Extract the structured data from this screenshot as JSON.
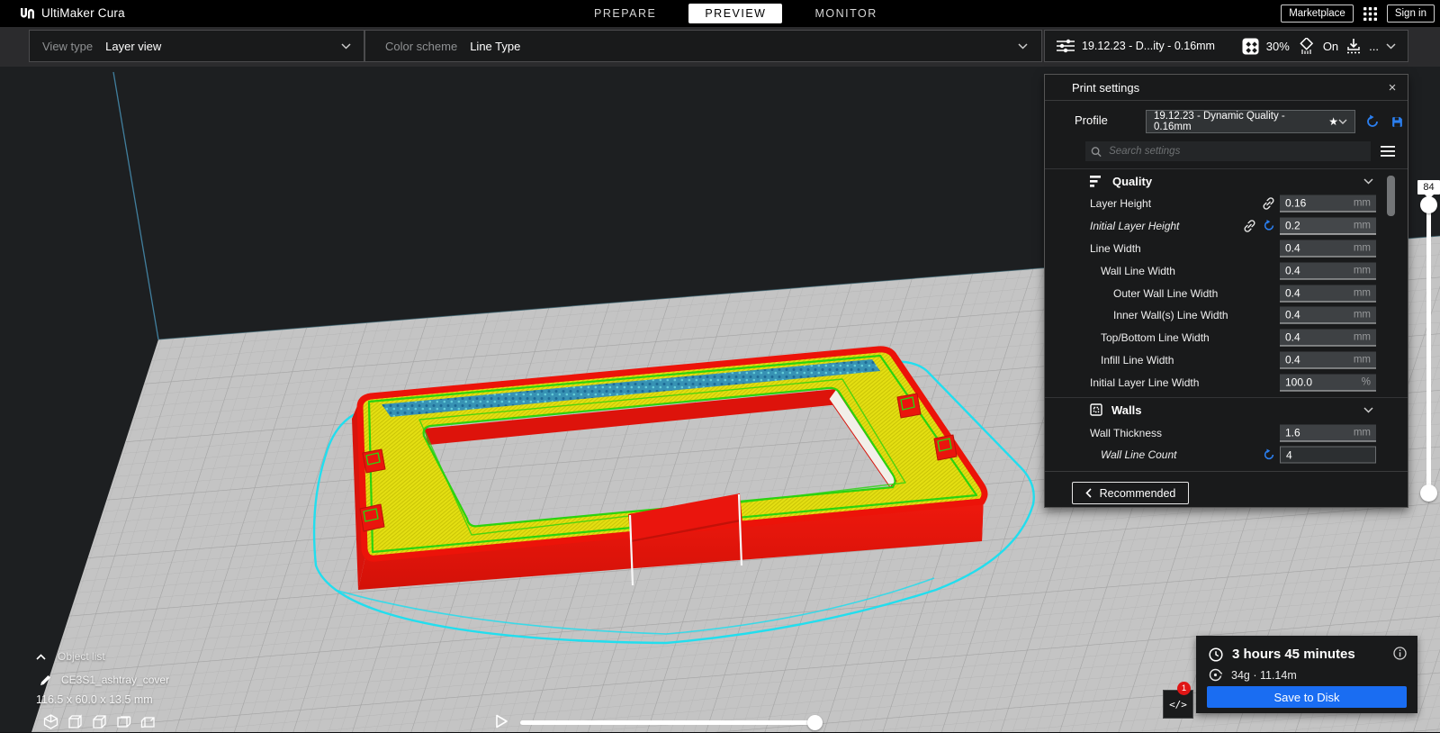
{
  "app": {
    "name": "UltiMaker Cura"
  },
  "top_bar": {
    "tabs": [
      {
        "label": "PREPARE"
      },
      {
        "label": "PREVIEW"
      },
      {
        "label": "MONITOR"
      }
    ],
    "active_tab": "PREVIEW",
    "marketplace_label": "Marketplace",
    "sign_in_label": "Sign in"
  },
  "view_bar": {
    "view_type_label": "View type",
    "view_type_value": "Layer view",
    "color_scheme_label": "Color scheme",
    "color_scheme_value": "Line Type",
    "summary": {
      "profile_short": "19.12.23 - D...ity - 0.16mm",
      "infill_percent": "30%",
      "support": "On",
      "more": "..."
    }
  },
  "print_settings": {
    "title": "Print settings",
    "profile_label": "Profile",
    "profile_value": "19.12.23 - Dynamic Quality - 0.16mm",
    "search_placeholder": "Search settings",
    "sections": [
      {
        "title": "Quality"
      },
      {
        "title": "Walls"
      }
    ],
    "rows": [
      {
        "label": "Layer Height",
        "value": "0.16",
        "unit": "mm"
      },
      {
        "label": "Initial Layer Height",
        "value": "0.2",
        "unit": "mm"
      },
      {
        "label": "Line Width",
        "value": "0.4",
        "unit": "mm"
      },
      {
        "label": "Wall Line Width",
        "value": "0.4",
        "unit": "mm"
      },
      {
        "label": "Outer Wall Line Width",
        "value": "0.4",
        "unit": "mm"
      },
      {
        "label": "Inner Wall(s) Line Width",
        "value": "0.4",
        "unit": "mm"
      },
      {
        "label": "Top/Bottom Line Width",
        "value": "0.4",
        "unit": "mm"
      },
      {
        "label": "Infill Line Width",
        "value": "0.4",
        "unit": "mm"
      },
      {
        "label": "Initial Layer Line Width",
        "value": "100.0",
        "unit": "%"
      },
      {
        "label": "Wall Thickness",
        "value": "1.6",
        "unit": "mm"
      },
      {
        "label": "Wall Line Count",
        "value": "4",
        "unit": ""
      }
    ],
    "recommended_label": "Recommended"
  },
  "layer_slider": {
    "current_layer": "84"
  },
  "scene": {
    "object_list_label": "Object list",
    "object_name": "CE3S1_ashtray_cover",
    "object_dimensions": "116.5 x 60.0 x 13.5 mm"
  },
  "job_panel": {
    "print_time": "3 hours 45 minutes",
    "material_usage": "34g · 11.14m",
    "save_button_label": "Save to Disk",
    "notification_count": "1"
  },
  "colors": {
    "accent_blue": "#1a6df2",
    "model_red": "#ea150d",
    "model_yellow": "#e4df12",
    "model_green": "#2bd30f",
    "model_teal": "#3792b4",
    "skirt_cyan": "#19dff0",
    "buildplate_gray": "#c4c4c4"
  }
}
